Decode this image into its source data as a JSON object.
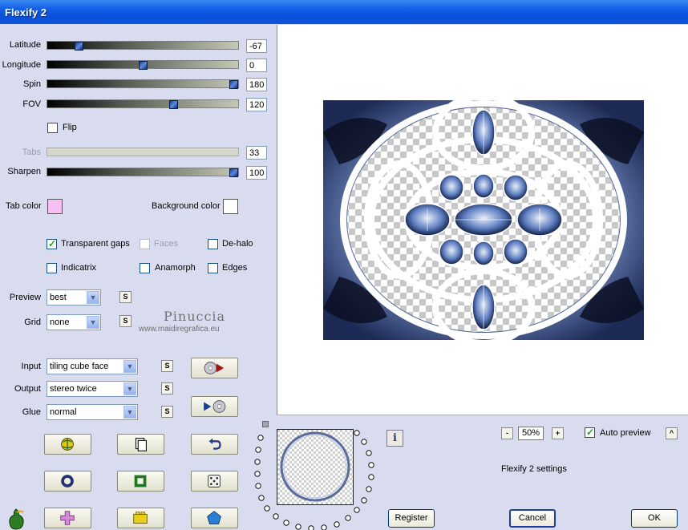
{
  "window": {
    "title": "Flexify 2"
  },
  "sliders": [
    {
      "label": "Latitude",
      "value": "-67",
      "level": 0.15
    },
    {
      "label": "Longitude",
      "value": "0",
      "level": 0.5
    },
    {
      "label": "Spin",
      "value": "180",
      "level": 1.0
    },
    {
      "label": "FOV",
      "value": "120",
      "level": 0.67
    },
    {
      "label": "Tabs",
      "value": "33",
      "level": 0
    },
    {
      "label": "Sharpen",
      "value": "100",
      "level": 1.0
    }
  ],
  "flip_label": "Flip",
  "colors": {
    "tab_label": "Tab color",
    "tab_value": "#f8c0f2",
    "bg_label": "Background color",
    "bg_value": "#ffffff"
  },
  "options": {
    "transparent_gaps": {
      "label": "Transparent gaps",
      "checked": true
    },
    "faces": {
      "label": "Faces",
      "checked": false
    },
    "dehalo": {
      "label": "De-halo",
      "checked": false
    },
    "indicatrix": {
      "label": "Indicatrix",
      "checked": false
    },
    "anamorph": {
      "label": "Anamorph",
      "checked": false
    },
    "edges": {
      "label": "Edges",
      "checked": false
    }
  },
  "preview_select": {
    "label": "Preview",
    "value": "best"
  },
  "grid_select": {
    "label": "Grid",
    "value": "none"
  },
  "input_select": {
    "label": "Input",
    "value": "tiling cube face"
  },
  "output_select": {
    "label": "Output",
    "value": "stereo twice"
  },
  "glue_select": {
    "label": "Glue",
    "value": "normal"
  },
  "small_button_label": "S",
  "watermark": {
    "name": "Pinuccia",
    "url": "www.maidiregrafica.eu"
  },
  "zoom": {
    "minus": "-",
    "value": "50%",
    "plus": "+"
  },
  "auto_preview": {
    "label": "Auto preview",
    "checked": true
  },
  "collapse_label": "^",
  "settings_text": "Flexify 2 settings",
  "info_label": "i",
  "buttons": {
    "register": "Register",
    "cancel": "Cancel",
    "ok": "OK"
  },
  "accent_colors": {
    "title_bar": "#0a4fd8",
    "panel": "#d9dcee",
    "slider_knob": "#1a3a8a"
  }
}
